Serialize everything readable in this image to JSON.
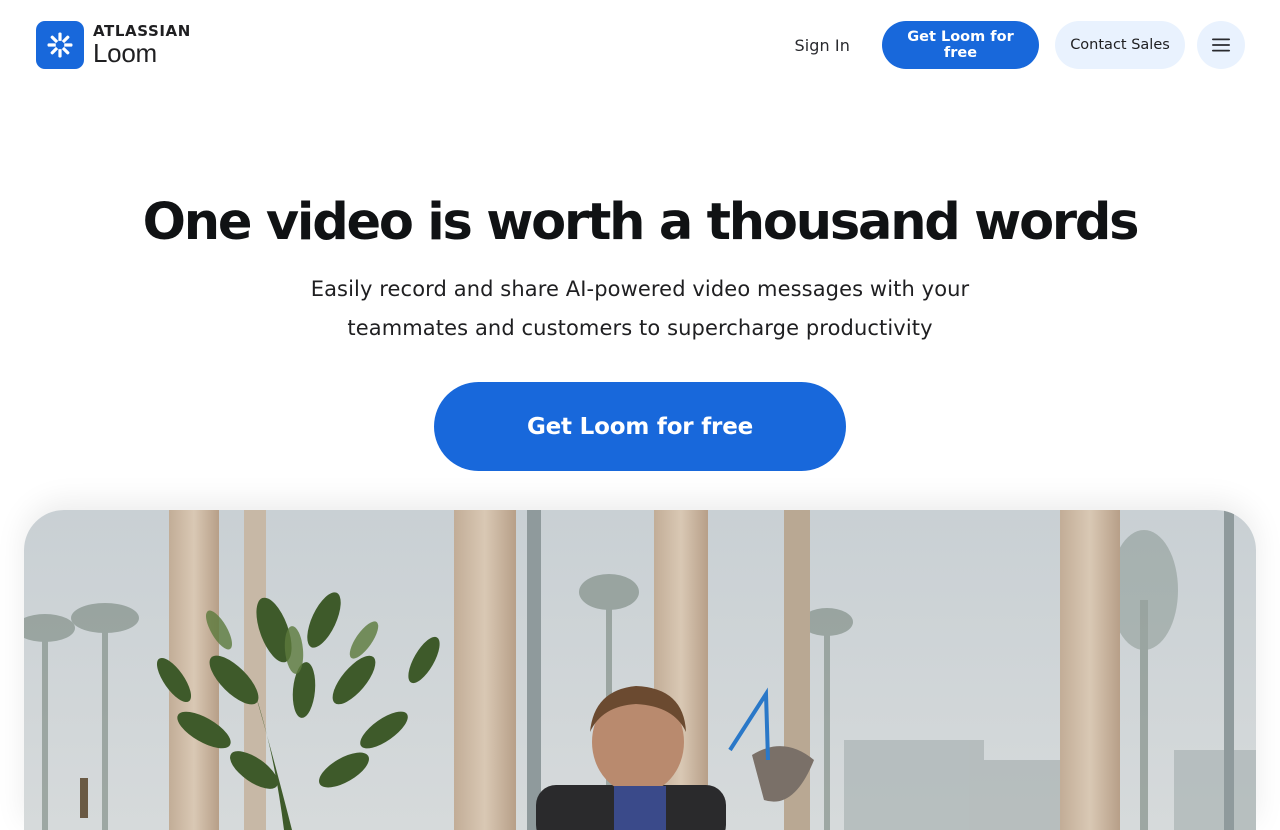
{
  "header": {
    "logo": {
      "brand": "ATLASSIAN",
      "product": "Loom",
      "icon": "loom-starburst-icon"
    },
    "nav": {
      "sign_in": "Sign In",
      "get_free": "Get Loom for free",
      "contact_sales": "Contact Sales",
      "menu_icon": "hamburger-menu-icon"
    }
  },
  "hero": {
    "title": "One video is worth a thousand words",
    "subtitle_line1": "Easily record and share AI-powered video messages with your",
    "subtitle_line2": "teammates and customers to supercharge productivity",
    "cta": "Get Loom for free"
  },
  "colors": {
    "accent": "#1868db",
    "secondary_bg": "#e9f2fe",
    "text": "#101214"
  }
}
